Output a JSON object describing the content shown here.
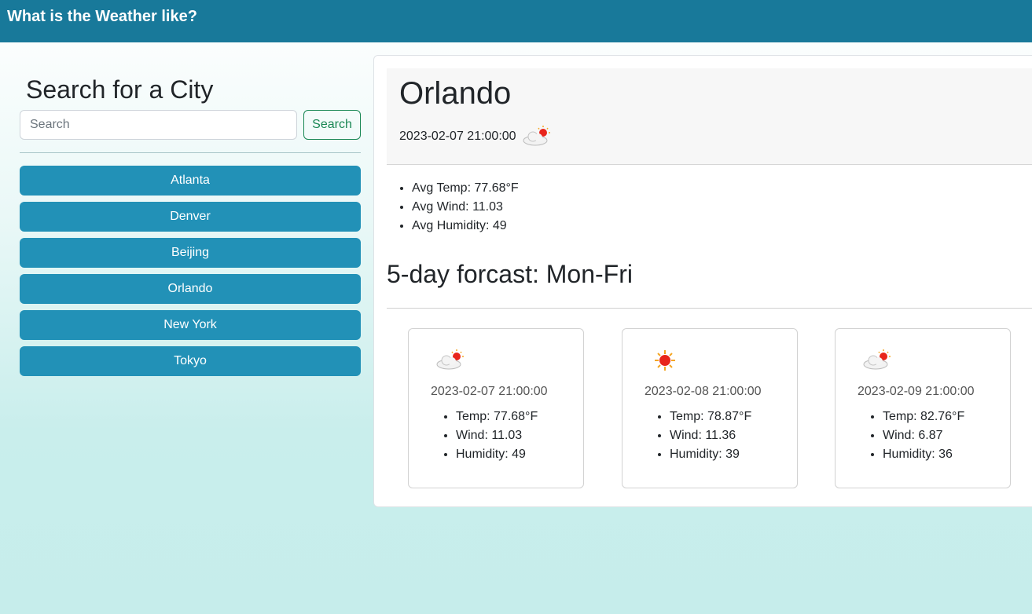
{
  "navbar": {
    "title": "What is the Weather like?"
  },
  "sidebar": {
    "heading": "Search for a City",
    "search_placeholder": "Search",
    "search_value": "",
    "search_button": "Search",
    "cities": [
      "Atlanta",
      "Denver",
      "Beijing",
      "Orlando",
      "New York",
      "Tokyo"
    ]
  },
  "current": {
    "city": "Orlando",
    "date": "2023-02-07 21:00:00",
    "icon": "partly-cloudy-icon",
    "stats": [
      "Avg Temp: 77.68°F",
      "Avg Wind: 11.03",
      "Avg Humidity: 49"
    ]
  },
  "forecast": {
    "title": "5-day forcast: Mon-Fri",
    "days": [
      {
        "icon": "partly-cloudy-icon",
        "date": "2023-02-07 21:00:00",
        "temp": "Temp: 77.68°F",
        "wind": "Wind: 11.03",
        "humidity": "Humidity: 49"
      },
      {
        "icon": "sun-icon",
        "date": "2023-02-08 21:00:00",
        "temp": "Temp: 78.87°F",
        "wind": "Wind: 11.36",
        "humidity": "Humidity: 39"
      },
      {
        "icon": "partly-cloudy-icon",
        "date": "2023-02-09 21:00:00",
        "temp": "Temp: 82.76°F",
        "wind": "Wind: 6.87",
        "humidity": "Humidity: 36"
      }
    ]
  },
  "colors": {
    "navbar": "#18799a",
    "city_button": "#2291b7",
    "search_button": "#198754"
  }
}
